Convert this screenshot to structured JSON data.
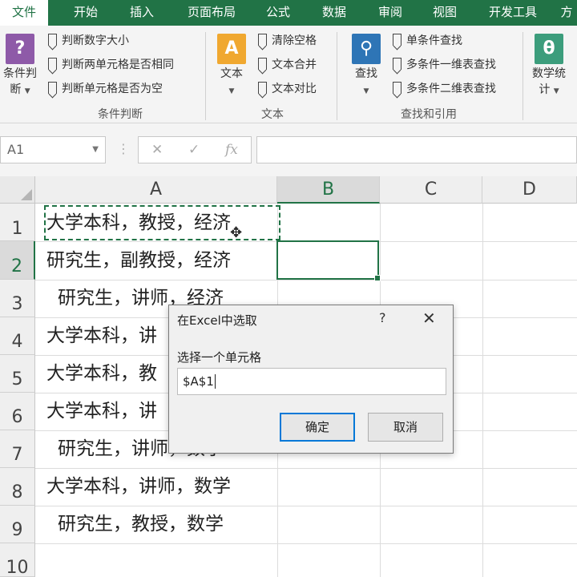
{
  "ribbon_tabs": [
    "文件",
    "开始",
    "插入",
    "页面布局",
    "公式",
    "数据",
    "审阅",
    "视图",
    "开发工具",
    "方"
  ],
  "groups": {
    "condition": {
      "big_button": {
        "label1": "条件判",
        "label2": "断",
        "icon": "question-book-icon"
      },
      "items": [
        "判断数字大小",
        "判断两单元格是否相同",
        "判断单元格是否为空"
      ],
      "label": "条件判断"
    },
    "text": {
      "big_button": {
        "label1": "文本",
        "icon": "text-book-icon"
      },
      "items": [
        "清除空格",
        "文本合并",
        "文本对比"
      ],
      "label": "文本"
    },
    "lookup": {
      "big_button": {
        "label1": "查找",
        "icon": "magnifier-book-icon"
      },
      "items": [
        "单条件查找",
        "多条件一维表查找",
        "多条件二维表查找"
      ],
      "label": "查找和引用"
    },
    "stats": {
      "big_button": {
        "label1": "数学统",
        "label2": "计",
        "icon": "theta-book-icon"
      }
    }
  },
  "formula_bar": {
    "name_box": "A1",
    "cancel": "✕",
    "enter": "✓",
    "fx": "fx",
    "formula": ""
  },
  "columns": [
    "A",
    "B",
    "C",
    "D"
  ],
  "rows": [
    "1",
    "2",
    "3",
    "4",
    "5",
    "6",
    "7",
    "8",
    "9",
    "10"
  ],
  "cells_a": [
    "大学本科，教授，经济",
    "研究生，副教授，经济",
    "研究生，讲师，经济",
    "大学本科，讲",
    "大学本科，教",
    "大学本科，讲",
    "研究生，讲师，数学",
    "大学本科，讲师，数学",
    "研究生，教授，数学",
    ""
  ],
  "dialog": {
    "title": "在Excel中选取",
    "help": "?",
    "close": "✕",
    "prompt": "选择一个单元格",
    "value": "$A$1",
    "ok": "确定",
    "cancel": "取消"
  },
  "colors": {
    "accent": "#217346",
    "dialog_focus": "#0078d7"
  }
}
